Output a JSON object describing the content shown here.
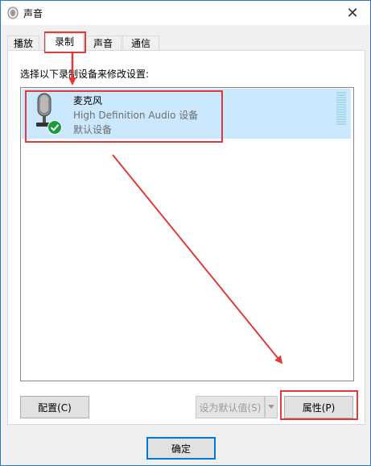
{
  "window": {
    "title": "声音"
  },
  "tabs": [
    {
      "label": "播放"
    },
    {
      "label": "录制"
    },
    {
      "label": "声音"
    },
    {
      "label": "通信"
    }
  ],
  "panel": {
    "instruction": "选择以下录制设备来修改设置:",
    "device": {
      "name": "麦克风",
      "description": "High Definition Audio 设备",
      "status": "默认设备"
    }
  },
  "buttons": {
    "configure": "配置(C)",
    "set_default": "设为默认值(S)",
    "properties": "属性(P)",
    "ok": "确定"
  },
  "colors": {
    "accent": "#0078d7",
    "selection": "#cce8ff",
    "annotation": "#e23a3a"
  }
}
